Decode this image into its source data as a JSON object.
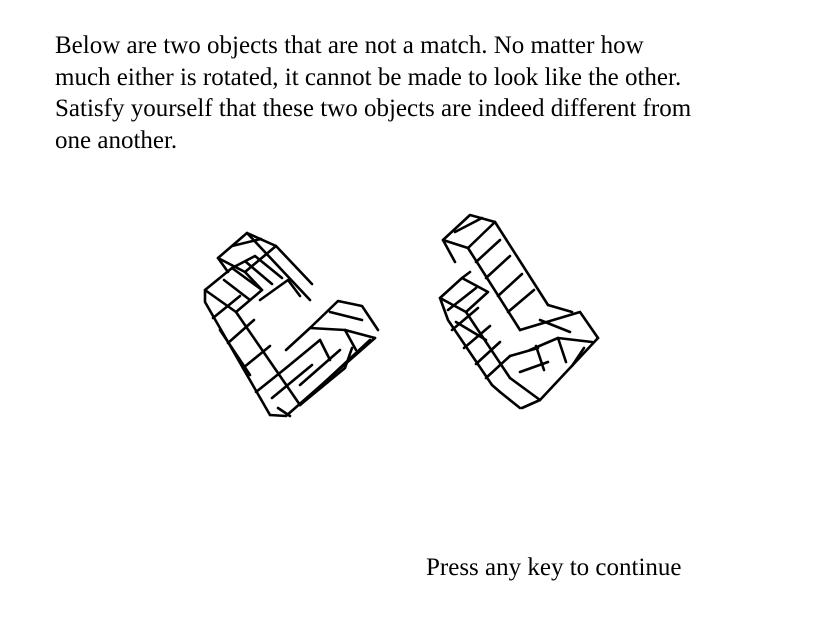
{
  "instructions": {
    "text": "Below are two objects that are not a match.  No matter how\nmuch either is rotated, it cannot be made to look like the other.\nSatisfy yourself that these two objects are indeed different from\none another."
  },
  "stimuli": {
    "left_object": "cube-figure",
    "right_object": "cube-figure",
    "match": false
  },
  "prompt": {
    "text": "Press any key to continue"
  }
}
